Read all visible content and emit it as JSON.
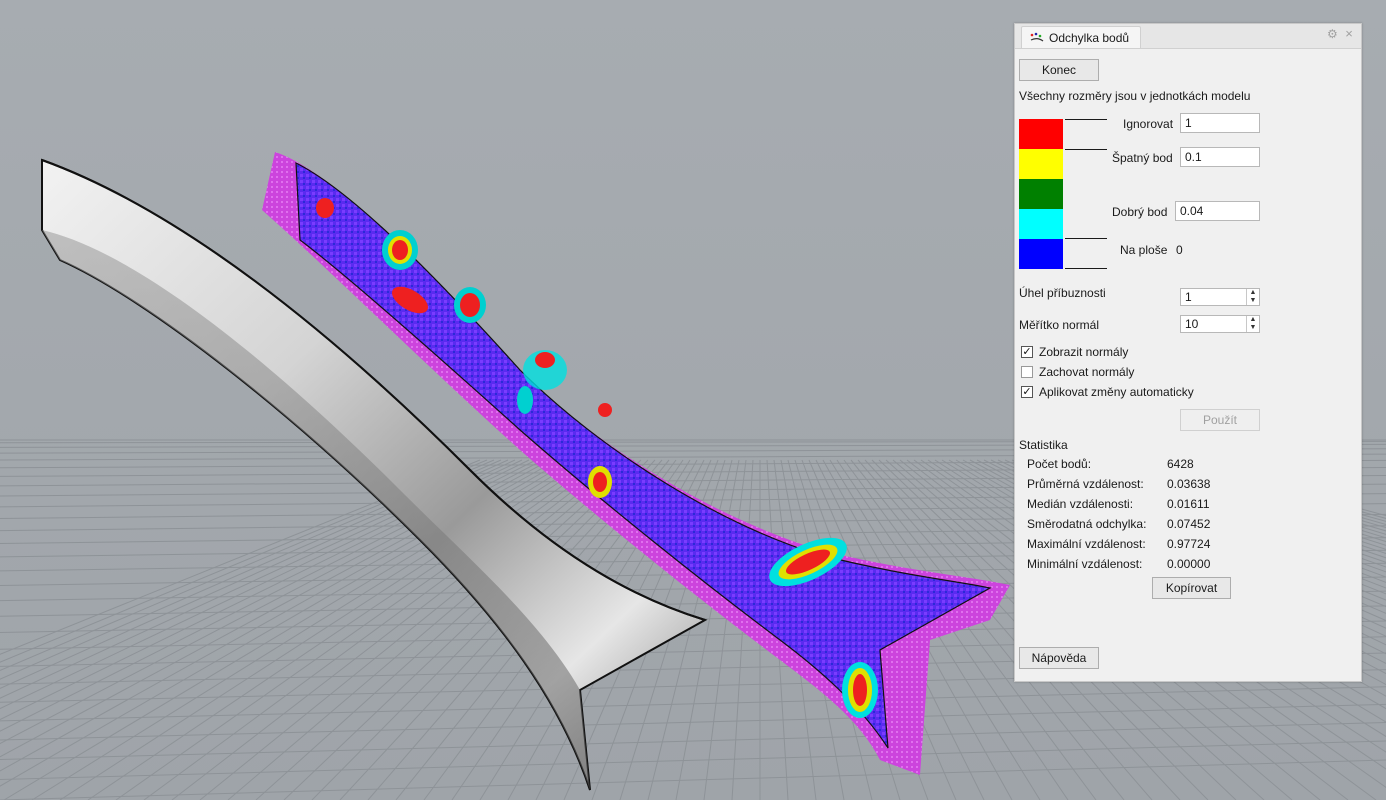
{
  "panel": {
    "title": "Odchylka bodů",
    "close_glyph": "×",
    "gear_glyph": "⚙",
    "finish_button": "Konec",
    "units_note": "Všechny rozměry jsou v jednotkách modelu",
    "legend": {
      "colors": [
        "#ff0000",
        "#ffff00",
        "#008000",
        "#00ffff",
        "#0000ff"
      ],
      "ignore_label": "Ignorovat",
      "ignore_value": "1",
      "bad_label": "Špatný bod",
      "bad_value": "0.1",
      "good_label": "Dobrý bod",
      "good_value": "0.04",
      "on_surface_label": "Na ploše",
      "on_surface_value": "0"
    },
    "angle_label": "Úhel příbuznosti",
    "angle_value": "1",
    "normal_scale_label": "Měřítko normál",
    "normal_scale_value": "10",
    "show_normals": {
      "label": "Zobrazit normály",
      "checked": true
    },
    "keep_normals": {
      "label": "Zachovat normály",
      "checked": false
    },
    "auto_apply": {
      "label": "Aplikovat změny automaticky",
      "checked": true
    },
    "apply_button": "Použít",
    "stats_heading": "Statistika",
    "stats": [
      {
        "label": "Počet bodů:",
        "value": "6428"
      },
      {
        "label": "Průměrná vzdálenost:",
        "value": "0.03638"
      },
      {
        "label": "Medián vzdálenosti:",
        "value": "0.01611"
      },
      {
        "label": "Směrodatná odchylka:",
        "value": "0.07452"
      },
      {
        "label": "Maximální vzdálenost:",
        "value": "0.97724"
      },
      {
        "label": "Minimální vzdálenost:",
        "value": "0.00000"
      }
    ],
    "copy_button": "Kopírovat",
    "help_button": "Nápověda"
  },
  "viewport": {
    "background": "#a4a9ae",
    "grid_color": "#8e9398",
    "point_cloud_color": "#cc44dd",
    "surface_color": "#5a2bf0"
  }
}
